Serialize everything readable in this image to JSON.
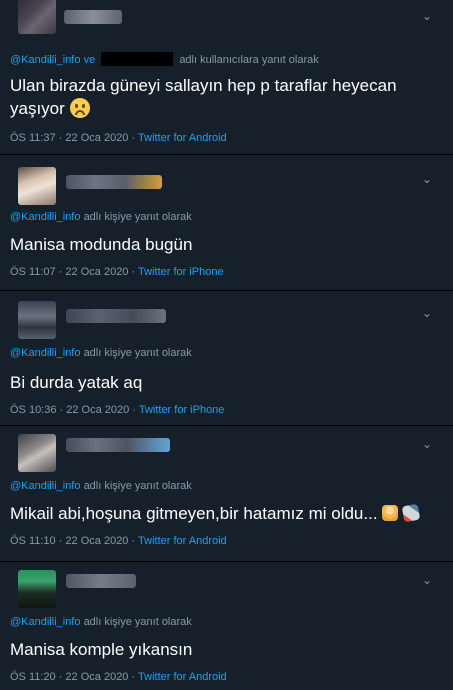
{
  "tweets": [
    {
      "reply_handle": "@Kandilli_info",
      "reply_connector": "ve",
      "reply_suffix": "adlı kullanıcılara yanıt olarak",
      "text": "Ulan birazda güneyi sallayın hep p taraflar heyecan yaşıyor",
      "emoji": "frowning-face",
      "time": "ÖS 11:37 · 22 Oca 2020 · ",
      "source": "Twitter for Android"
    },
    {
      "reply_handle": "@Kandilli_info",
      "reply_suffix": "adlı kişiye yanıt olarak",
      "text": "Manisa modunda bugün",
      "time": "ÖS 11:07 · 22 Oca 2020 · ",
      "source": "Twitter for iPhone"
    },
    {
      "reply_handle": "@Kandilli_info",
      "reply_suffix": "adlı kişiye yanıt olarak",
      "text": "Bi durda yatak aq",
      "time": "ÖS 10:36 · 22 Oca 2020 · ",
      "source": "Twitter for iPhone"
    },
    {
      "reply_handle": "@Kandilli_info",
      "reply_suffix": "adlı kişiye yanıt olarak",
      "text": "Mikail abi,hoşuna gitmeyen,bir hatamız mi oldu...",
      "emojis": [
        "person-emoji",
        "rocket-emoji"
      ],
      "time": "ÖS 11:10 · 22 Oca 2020 · ",
      "source": "Twitter for Android"
    },
    {
      "reply_handle": "@Kandilli_info",
      "reply_suffix": "adlı kişiye yanıt olarak",
      "text": "Manisa komple yıkansın",
      "time": "ÖS 11:20 · 22 Oca 2020 · ",
      "source": "Twitter for Android"
    }
  ],
  "colors": {
    "background": "#15202b",
    "link": "#1da1f2",
    "muted": "#8899a6",
    "divider": "#000000"
  },
  "icons": {
    "menu": "chevron-down-icon"
  }
}
